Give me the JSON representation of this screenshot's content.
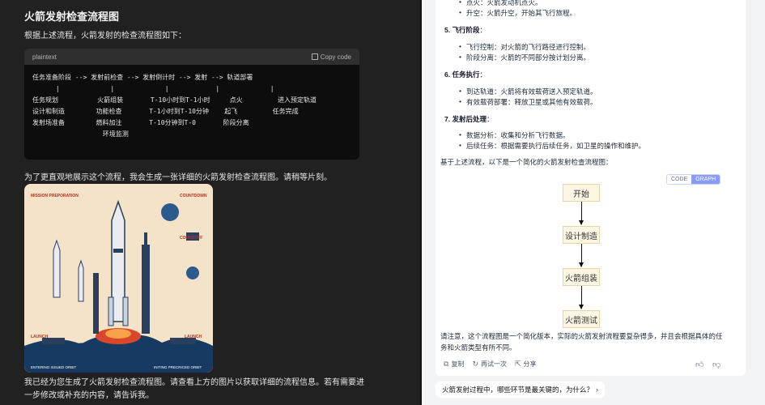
{
  "left": {
    "heading": "火箭发射检查流程图",
    "intro": "根据上述流程，火箭发射的检查流程图如下：",
    "code": {
      "lang": "plaintext",
      "copy_label": "Copy code",
      "content": "任务准备阶段 --> 发射前检查 --> 发射倒计时 --> 发射 --> 轨道部署\n      |             |             |            |             |\n任务规划          火箭组装       T-10小时到T-1小时     点火         进入预定轨道\n设计和制造        功能检查       T-1小时到T-10分钟    起飞         任务完成\n发射场准备        燃料加注       T-10分钟到T-0       阶段分离\n                  环境监测"
    },
    "image_intro": "为了更直观地展示这个流程，我会生成一张详细的火箭发射检查流程图。请稍等片刻。",
    "poster": {
      "labels": [
        "MISSION PREPORATION",
        "COUNTDOWN",
        "COUNDOFF",
        "LAUNCH",
        "LAUNCH",
        "ENTERING ISSUED ORBIT",
        "INITING PRECRICED ORBIT"
      ]
    },
    "outro": "我已经为您生成了火箭发射检查流程图。请查看上方的图片以获取详细的流程信息。若有需要进一步修改或补充的内容，请告诉我。"
  },
  "right": {
    "top_items": [
      "点火：火箭发动机点火。",
      "升空：火箭升空，开始其飞行旅程。"
    ],
    "sections": [
      {
        "title": "5. 飞行阶段",
        "suffix": "：",
        "items": [
          "飞行控制：对火箭的飞行路径进行控制。",
          "阶段分离：火箭的不同部分按计划分离。"
        ]
      },
      {
        "title": "6. 任务执行",
        "suffix": "：",
        "items": [
          "到达轨道：火箭将有效载荷送入预定轨道。",
          "有效载荷部署：释放卫星或其他有效载荷。"
        ]
      },
      {
        "title": "7. 发射后处理",
        "suffix": "：",
        "items": [
          "数据分析：收集和分析飞行数据。",
          "后续任务：根据需要执行后续任务，如卫星的操作和维护。"
        ]
      }
    ],
    "summary_intro": "基于上述流程，以下是一个简化的火箭发射检查流程图：",
    "toggle": {
      "code": "CODE",
      "graph": "GRAPH"
    },
    "flow_nodes": [
      "开始",
      "设计制造",
      "火箭组装",
      "火箭测试"
    ],
    "note": "请注意，这个流程图是一个简化版本，实际的火箭发射流程要复杂得多，并且会根据具体的任务和火箭类型有所不同。",
    "actions": {
      "copy": "复制",
      "retry": "再试一次",
      "share": "分享"
    },
    "suggestion": "火箭发射过程中，哪些环节是最关键的，为什么？"
  }
}
